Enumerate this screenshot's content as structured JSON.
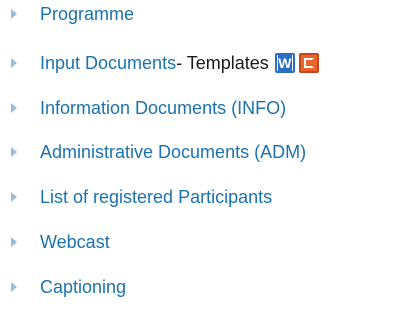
{
  "nav": {
    "items": [
      {
        "label": "Programme"
      },
      {
        "label": "Input Documents",
        "suffix": " - Templates"
      },
      {
        "label": "Information Documents (INFO)"
      },
      {
        "label": "Administrative Documents (ADM)"
      },
      {
        "label": "List of registered Participants"
      },
      {
        "label": "Webcast"
      },
      {
        "label": "Captioning"
      }
    ]
  },
  "icons": {
    "word": "word-document-icon",
    "powerpoint": "powerpoint-document-icon",
    "bullet": "triangle-bullet-icon"
  },
  "colors": {
    "link": "#1a73b0",
    "bullet": "#9dbbd8",
    "text": "#1a1a1a"
  }
}
